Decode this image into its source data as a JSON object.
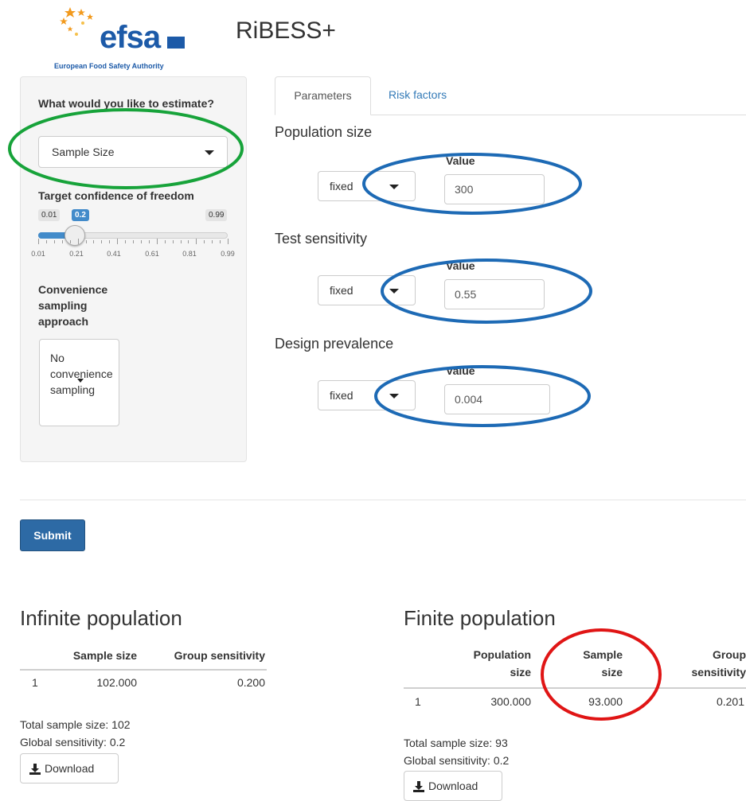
{
  "header": {
    "logo_text": "efsa",
    "logo_subtitle": "European Food Safety Authority",
    "app_title": "RiBESS+"
  },
  "sidebar": {
    "estimate_label": "What would you like to estimate?",
    "estimate_value": "Sample Size",
    "confidence_label": "Target confidence of freedom",
    "slider": {
      "min_label": "0.01",
      "max_label": "0.99",
      "value_label": "0.2",
      "min": 0.01,
      "max": 0.99,
      "value": 0.2,
      "tick_labels": [
        "0.01",
        "0.21",
        "0.41",
        "0.61",
        "0.81",
        "0.99"
      ]
    },
    "convenience_label_lines": [
      "Convenience",
      "sampling",
      "approach"
    ],
    "convenience_value_lines": [
      "No",
      "convenience",
      "sampling"
    ]
  },
  "tabs": [
    {
      "label": "Parameters",
      "active": true
    },
    {
      "label": "Risk factors",
      "active": false
    }
  ],
  "parameters": [
    {
      "title": "Population size",
      "dist": "fixed",
      "value_label": "Value",
      "value": "300"
    },
    {
      "title": "Test sensitivity",
      "dist": "fixed",
      "value_label": "Value",
      "value": "0.55"
    },
    {
      "title": "Design prevalence",
      "dist": "fixed",
      "value_label": "Value",
      "value": "0.004"
    }
  ],
  "submit_label": "Submit",
  "infinite": {
    "title": "Infinite population",
    "headers": [
      "Sample size",
      "Group sensitivity"
    ],
    "rows": [
      [
        "1",
        "102.000",
        "0.200"
      ]
    ],
    "total_sample": "Total sample size: 102",
    "global_sensitivity": "Global sensitivity: 0.2",
    "download_label": "Download"
  },
  "finite": {
    "title": "Finite population",
    "headers": [
      [
        "Population",
        "size"
      ],
      [
        "Sample",
        "size"
      ],
      [
        "Group",
        "sensitivity"
      ]
    ],
    "rows": [
      [
        "1",
        "300.000",
        "93.000",
        "0.201"
      ]
    ],
    "total_sample": "Total sample size: 93",
    "global_sensitivity": "Global sensitivity: 0.2",
    "download_label": "Download"
  },
  "colors": {
    "annotation_green": "#17a33a",
    "annotation_blue": "#1d6ab5",
    "annotation_red": "#e01515",
    "accent": "#428bca",
    "submit": "#2d6aa5"
  }
}
